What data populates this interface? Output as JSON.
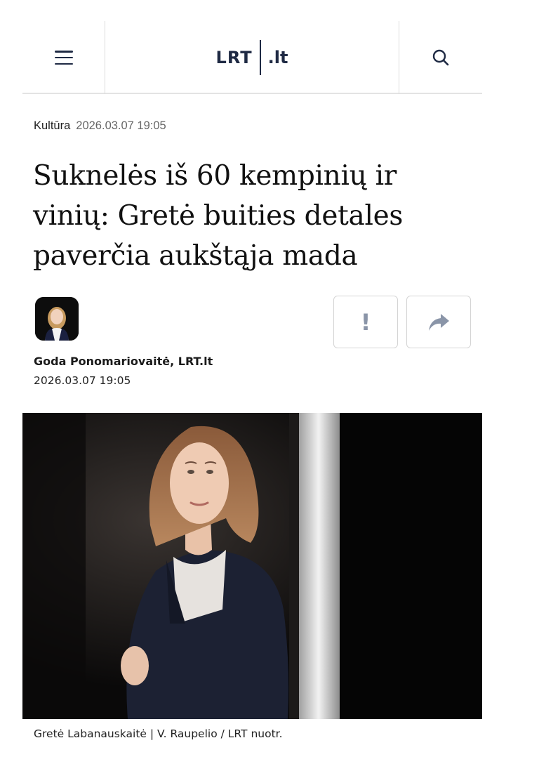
{
  "header": {
    "logo_main": "LRT",
    "logo_tld": ".lt"
  },
  "article": {
    "category": "Kultūra",
    "datetime": "2026.03.07 19:05",
    "title": "Suknelės iš 60 kempinių ir vinių: Gretė buities detales paverčia aukštąja mada",
    "author": "Goda Ponomariovaitė, LRT.lt",
    "published": "2026.03.07 19:05",
    "actions": {
      "report_label": "!"
    },
    "photo_caption": "Gretė Labanauskaitė | V. Raupelio / LRT nuotr."
  },
  "icons": {
    "menu": "menu-icon",
    "search": "search-icon",
    "share": "share-arrow-icon"
  },
  "colors": {
    "brand": "#1f2a44",
    "icon_muted": "#8a95a8"
  }
}
